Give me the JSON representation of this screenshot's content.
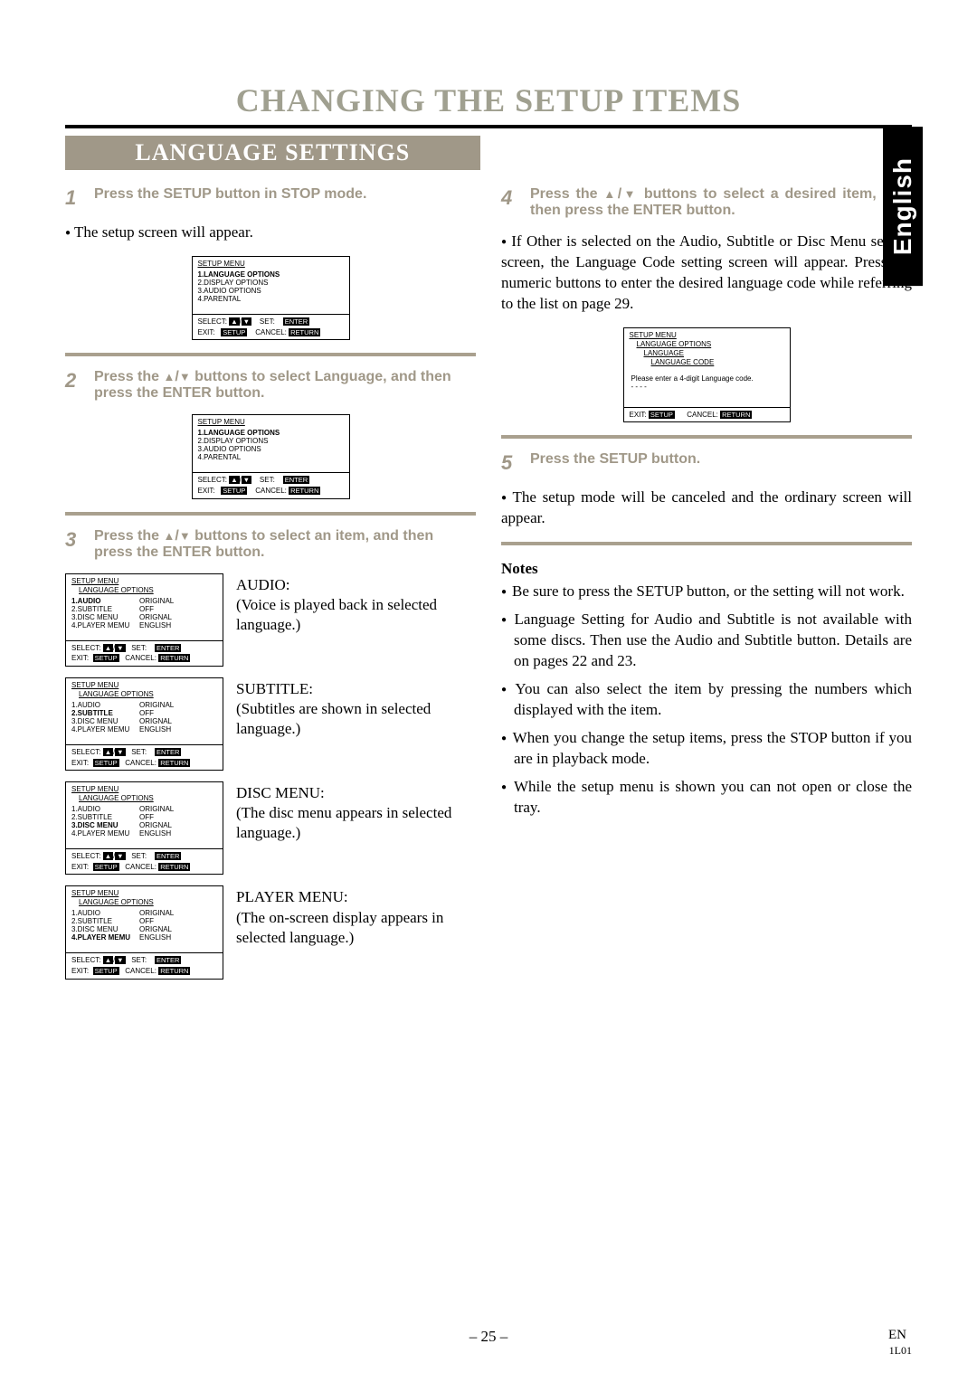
{
  "page_title": "CHANGING THE SETUP ITEMS",
  "banner": "LANGUAGE SETTINGS",
  "lang_tab": "English",
  "steps": {
    "s1": {
      "num": "1",
      "text": "Press the SETUP button in STOP mode."
    },
    "s2": {
      "num": "2",
      "text_before": "Press the ",
      "text_after": " buttons to select Language, and then press the ENTER button."
    },
    "s3": {
      "num": "3",
      "text_before": "Press the ",
      "text_after": " buttons to select an item, and then press the ENTER button."
    },
    "s4": {
      "num": "4",
      "text_before": "Press the ",
      "text_after": " buttons to select a desired item, and then press the ENTER button."
    },
    "s5": {
      "num": "5",
      "text": "Press the SETUP button."
    }
  },
  "body": {
    "after1": "The setup screen will appear.",
    "after4": "If Other is selected on the Audio, Subtitle or Disc Menu setting screen, the Language Code setting screen will appear. Press the numeric buttons to enter the desired language code while referring to the list on page 29.",
    "after5": "The setup mode will be canceled and the ordinary screen will appear."
  },
  "options": {
    "audio": {
      "title": "AUDIO:",
      "desc": "(Voice is played back in selected language.)"
    },
    "subtitle": {
      "title": "SUBTITLE:",
      "desc": "(Subtitles are shown in selected language.)"
    },
    "disc": {
      "title": "DISC MENU:",
      "desc": "(The disc menu appears in selected language.)"
    },
    "player": {
      "title": "PLAYER MENU:",
      "desc": "(The on-screen display appears in selected language.)"
    }
  },
  "osd_main": {
    "title": "SETUP MENU",
    "items": [
      "1.LANGUAGE OPTIONS",
      "2.DISPLAY OPTIONS",
      "3.AUDIO OPTIONS",
      "4.PARENTAL"
    ],
    "select": "SELECT:",
    "set": "SET:",
    "set_btn": "ENTER",
    "exit": "EXIT:",
    "exit_btn": "SETUP",
    "cancel": "CANCEL:",
    "cancel_btn": "RETURN"
  },
  "osd_lang": {
    "title": "SETUP MENU",
    "subtitle": "LANGUAGE OPTIONS",
    "rows": [
      {
        "l": "1.AUDIO",
        "r": "ORIGINAL"
      },
      {
        "l": "2.SUBTITLE",
        "r": "OFF"
      },
      {
        "l": "3.DISC MENU",
        "r": "ORIGNAL"
      },
      {
        "l": "4.PLAYER MEMU",
        "r": "ENGLISH"
      }
    ]
  },
  "osd_code": {
    "title": "SETUP MENU",
    "sub1": "LANGUAGE OPTIONS",
    "sub2": "LANGUAGE",
    "sub3": "LANGUAGE CODE",
    "prompt": "Please enter a 4-digit Language code.",
    "placeholder": "- - - -"
  },
  "notes_head": "Notes",
  "notes": [
    "Be sure to press the SETUP button, or the setting will not work.",
    "Language Setting for Audio and Subtitle is not available with some discs. Then use the Audio and Subtitle button. Details are on pages 22 and 23.",
    "You can also select the item by pressing the numbers which displayed with the item.",
    "When you change the setup items, press the STOP button if you are in playback mode.",
    "While the setup menu is shown you can not open or close the tray."
  ],
  "footer": {
    "page": "– 25 –",
    "en": "EN",
    "code": "1L01"
  }
}
